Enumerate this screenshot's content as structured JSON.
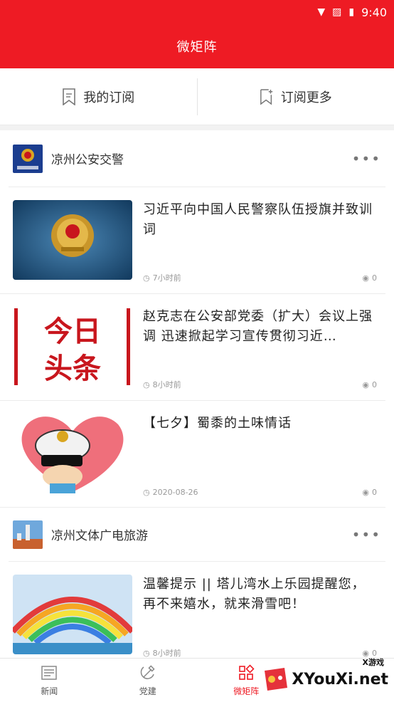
{
  "status": {
    "time": "9:40"
  },
  "header": {
    "title": "微矩阵"
  },
  "subscribe": {
    "mine": "我的订阅",
    "more": "订阅更多"
  },
  "channels": [
    {
      "name": "凉州公安交警",
      "articles": [
        {
          "title": "习近平向中国人民警察队伍授旗并致训词",
          "time": "7小时前",
          "views": "0"
        },
        {
          "title": "赵克志在公安部党委（扩大）会议上强调 迅速掀起学习宣传贯彻习近…",
          "time": "8小时前",
          "views": "0"
        },
        {
          "title": "【七夕】蜀黍的土味情话",
          "time": "2020-08-26",
          "views": "0"
        }
      ]
    },
    {
      "name": "凉州文体广电旅游",
      "articles": [
        {
          "title": "温馨提示 || 塔儿湾水上乐园提醒您，再不来嬉水，就来滑雪吧！",
          "time": "8小时前",
          "views": "0"
        }
      ]
    }
  ],
  "thumb_text": {
    "headline_top": "今日",
    "headline_bottom": "头条"
  },
  "nav": {
    "news": "新闻",
    "party": "党建",
    "matrix": "微矩阵"
  },
  "watermark": {
    "brand": "XYouXi.net",
    "small": "X游戏"
  },
  "colors": {
    "accent": "#ee1b24"
  }
}
